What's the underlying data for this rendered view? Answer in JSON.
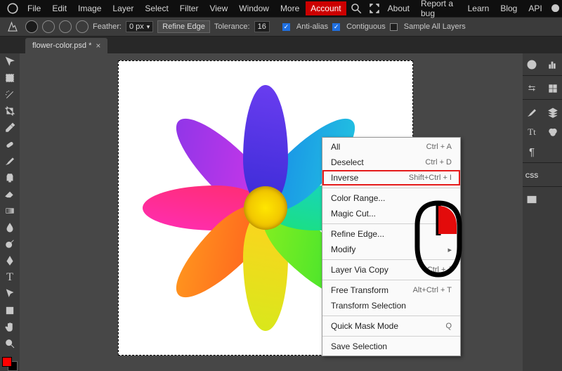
{
  "menubar": {
    "left": [
      "File",
      "Edit",
      "Image",
      "Layer",
      "Select",
      "Filter",
      "View",
      "Window",
      "More"
    ],
    "account": "Account",
    "right": [
      "About",
      "Report a bug",
      "Learn",
      "Blog",
      "API"
    ]
  },
  "optionbar": {
    "feather_label": "Feather:",
    "feather_value": "0 px",
    "refine_edge": "Refine Edge",
    "tolerance_label": "Tolerance:",
    "tolerance_value": "16",
    "antialias": "Anti-alias",
    "contiguous": "Contiguous",
    "sample_all": "Sample All Layers"
  },
  "tab": {
    "title": "flower-color.psd *",
    "close": "×"
  },
  "tools": [
    "move",
    "select-rect",
    "magic-wand",
    "crop",
    "eyedropper",
    "heal",
    "brush",
    "clone",
    "eraser",
    "gradient",
    "blur",
    "flame",
    "pen",
    "text-tool",
    "path",
    "shape",
    "hand",
    "zoom"
  ],
  "swatch": {
    "fg": "#ff0000",
    "bg": "#000000"
  },
  "rpanels": {
    "r1": [
      "info-icon",
      "histogram-icon"
    ],
    "r2": [
      "swatches-icon",
      "adjust-icon"
    ],
    "r3": [
      "brush-icon",
      "layers-icon"
    ],
    "r4": [
      "type-icon",
      "channels-icon"
    ],
    "r5": [
      "paragraph-icon",
      ""
    ],
    "r6": [
      "css-icon",
      ""
    ],
    "r7": [
      "image-icon",
      ""
    ]
  },
  "context_menu": {
    "items": [
      {
        "label": "All",
        "shortcut": "Ctrl + A"
      },
      {
        "label": "Deselect",
        "shortcut": "Ctrl + D"
      },
      {
        "label": "Inverse",
        "shortcut": "Shift+Ctrl + I",
        "highlight": true
      },
      {
        "sep": true
      },
      {
        "label": "Color Range...",
        "shortcut": ""
      },
      {
        "label": "Magic Cut...",
        "shortcut": ""
      },
      {
        "sep": true
      },
      {
        "label": "Refine Edge...",
        "shortcut": ""
      },
      {
        "label": "Modify",
        "shortcut": "▸"
      },
      {
        "sep": true
      },
      {
        "label": "Layer Via Copy",
        "shortcut": "Ctrl + J"
      },
      {
        "sep": true
      },
      {
        "label": "Free Transform",
        "shortcut": "Alt+Ctrl + T"
      },
      {
        "label": "Transform Selection",
        "shortcut": ""
      },
      {
        "sep": true
      },
      {
        "label": "Quick Mask Mode",
        "shortcut": "Q"
      },
      {
        "sep": true
      },
      {
        "label": "Save Selection",
        "shortcut": ""
      }
    ]
  },
  "petals": [
    {
      "rot": 0,
      "c1": "#3a2bd6",
      "c2": "#6a3df0"
    },
    {
      "rot": 45,
      "c1": "#1787e8",
      "c2": "#23c6e0"
    },
    {
      "rot": 90,
      "c1": "#17d3c3",
      "c2": "#1be080"
    },
    {
      "rot": 135,
      "c1": "#2fe033",
      "c2": "#8cf01e"
    },
    {
      "rot": 180,
      "c1": "#d8e81b",
      "c2": "#ffd21e"
    },
    {
      "rot": 225,
      "c1": "#ff9b1e",
      "c2": "#ff5a1e"
    },
    {
      "rot": 270,
      "c1": "#ff2d71",
      "c2": "#ff2db5"
    },
    {
      "rot": 315,
      "c1": "#d236e8",
      "c2": "#8b36e8"
    }
  ]
}
